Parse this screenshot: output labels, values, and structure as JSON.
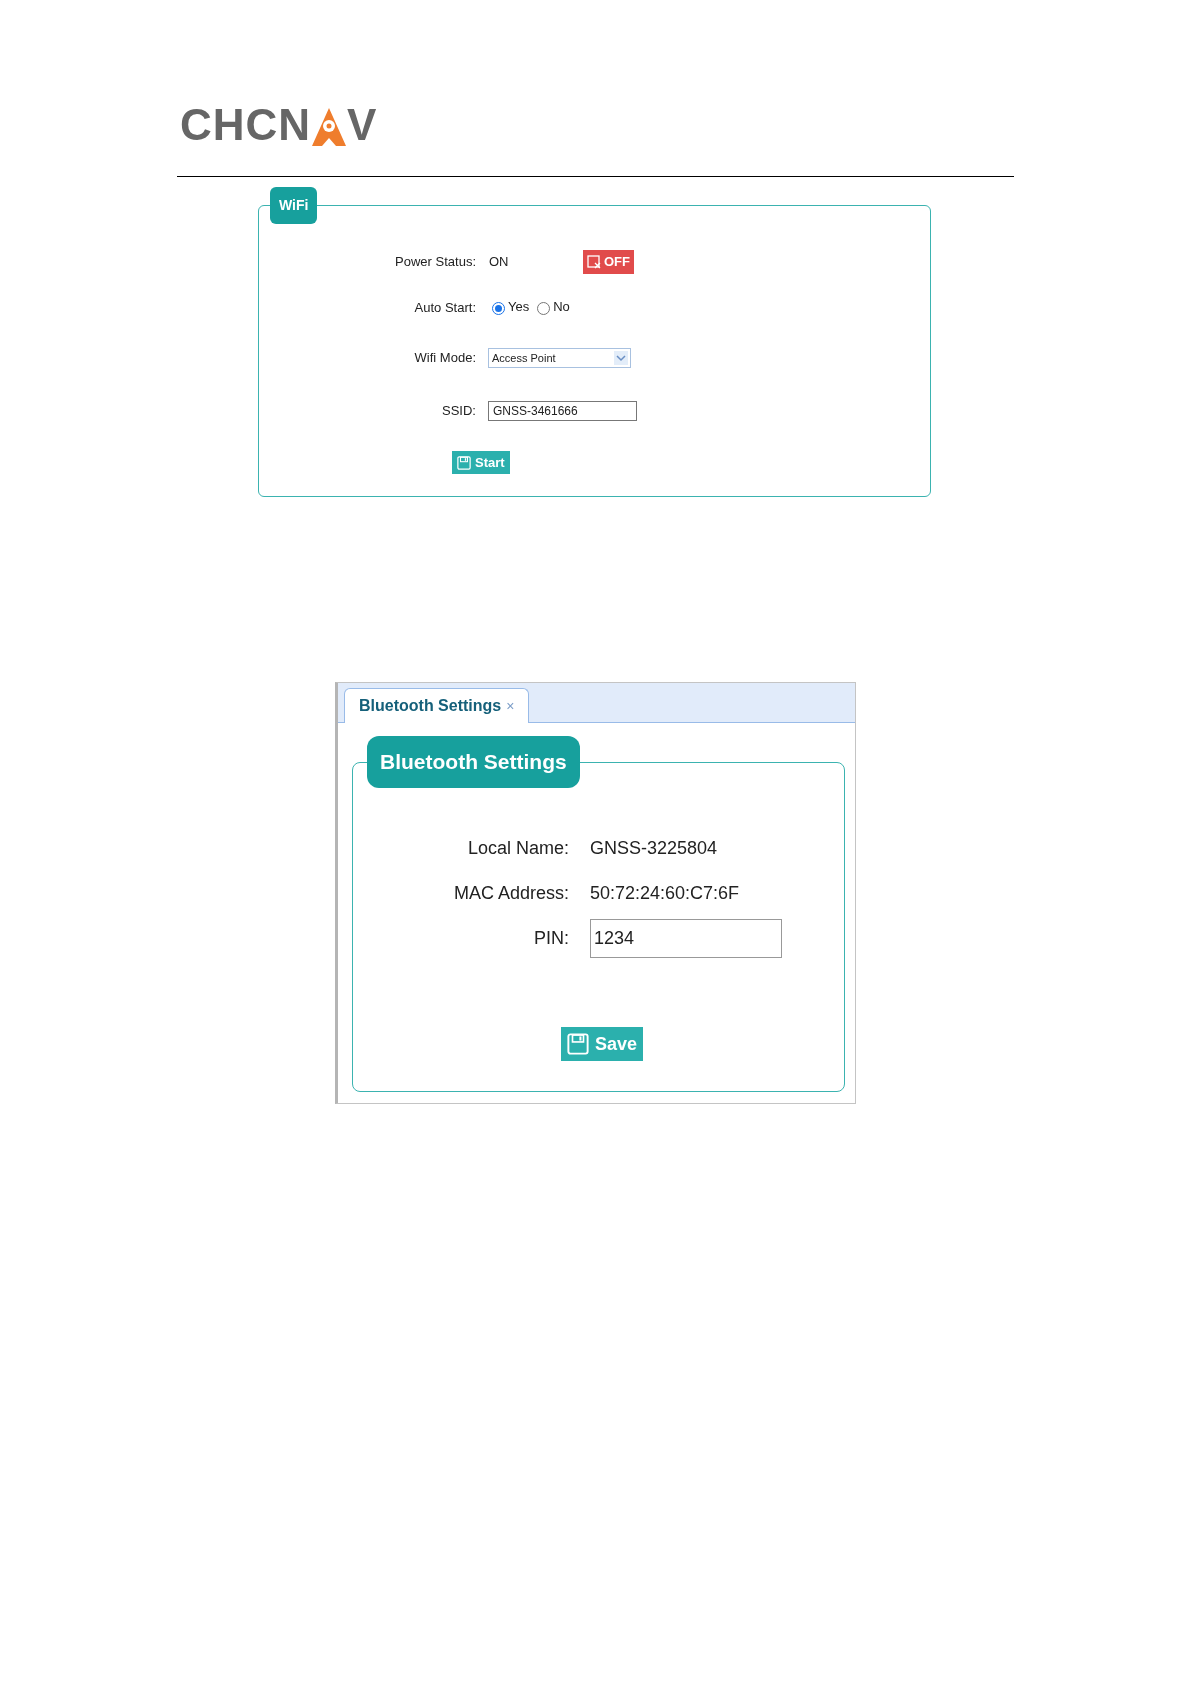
{
  "logo": {
    "parts": [
      "CHCN",
      "V"
    ]
  },
  "wifi": {
    "title": "WiFi",
    "power_status": {
      "label": "Power Status:",
      "value": "ON",
      "button": "OFF"
    },
    "auto_start": {
      "label": "Auto Start:",
      "options": [
        {
          "label": "Yes",
          "selected": true
        },
        {
          "label": "No",
          "selected": false
        }
      ]
    },
    "wifi_mode": {
      "label": "Wifi Mode:",
      "value": "Access Point"
    },
    "ssid": {
      "label": "SSID:",
      "value": "GNSS-3461666"
    },
    "start_button": "Start"
  },
  "bluetooth": {
    "tabs": [
      {
        "label": "Bluetooth Settings",
        "close": "×",
        "selected": true
      }
    ],
    "title": "Bluetooth Settings",
    "fields": [
      {
        "kind": "text",
        "label": "Local Name:",
        "value": "GNSS-3225804"
      },
      {
        "kind": "text",
        "label": "MAC Address:",
        "value": "50:72:24:60:C7:6F"
      },
      {
        "kind": "input",
        "label": "PIN:",
        "value": "1234"
      }
    ],
    "save_button": "Save"
  }
}
